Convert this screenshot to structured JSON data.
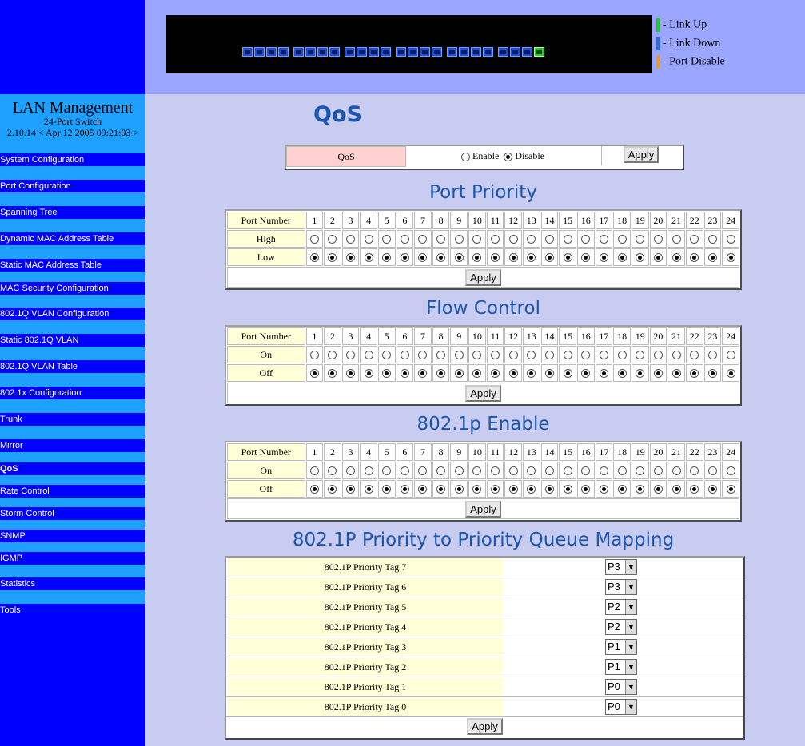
{
  "sidebar": {
    "title": "LAN Management",
    "subtitle": "24-Port Switch",
    "version": "2.10.14 < Apr 12 2005 09:21:03 >",
    "items": [
      {
        "label": "System Configuration"
      },
      {
        "label": "Port Configuration"
      },
      {
        "label": "Spanning Tree"
      },
      {
        "label": "Dynamic MAC Address Table"
      },
      {
        "label": "Static MAC Address Table"
      },
      {
        "label": "MAC Security Configuration"
      },
      {
        "label": "802.1Q VLAN Configuration"
      },
      {
        "label": "Static 802.1Q VLAN"
      },
      {
        "label": "802.1Q VLAN Table"
      },
      {
        "label": "802.1x Configuration"
      },
      {
        "label": "Trunk"
      },
      {
        "label": "Mirror"
      },
      {
        "label": "QoS",
        "active": true
      },
      {
        "label": "Rate Control"
      },
      {
        "label": "Storm Control"
      },
      {
        "label": "SNMP"
      },
      {
        "label": "IGMP"
      },
      {
        "label": "Statistics"
      },
      {
        "label": " Tools"
      }
    ]
  },
  "legend": [
    {
      "label": "- Link Up",
      "color": "#22cc22"
    },
    {
      "label": "- Link Down",
      "color": "#2a6ae8"
    },
    {
      "label": "- Port Disable",
      "color": "#e89a2a"
    }
  ],
  "ports_up": [
    24
  ],
  "page_title": "QoS",
  "qos": {
    "label": "QoS",
    "enable_label": "Enable",
    "disable_label": "Disable",
    "selected": "Disable",
    "apply": "Apply"
  },
  "port_priority": {
    "title": "Port Priority",
    "header": "Port Number",
    "rows": [
      {
        "label": "High",
        "checked": false
      },
      {
        "label": "Low",
        "checked": true
      }
    ],
    "apply": "Apply"
  },
  "flow_control": {
    "title": "Flow Control",
    "header": "Port Number",
    "rows": [
      {
        "label": "On",
        "checked": false
      },
      {
        "label": "Off",
        "checked": true
      }
    ],
    "apply": "Apply"
  },
  "p8021p_enable": {
    "title": "802.1p Enable",
    "header": "Port Number",
    "rows": [
      {
        "label": "On",
        "checked": false
      },
      {
        "label": "Off",
        "checked": true
      }
    ],
    "apply": "Apply"
  },
  "ports": [
    "1",
    "2",
    "3",
    "4",
    "5",
    "6",
    "7",
    "8",
    "9",
    "10",
    "11",
    "12",
    "13",
    "14",
    "15",
    "16",
    "17",
    "18",
    "19",
    "20",
    "21",
    "22",
    "23",
    "24"
  ],
  "mapping": {
    "title": "802.1P Priority to Priority Queue Mapping",
    "rows": [
      {
        "label": "802.1P Priority Tag 7",
        "value": "P3"
      },
      {
        "label": "802.1P Priority Tag 6",
        "value": "P3"
      },
      {
        "label": "802.1P Priority Tag 5",
        "value": "P2"
      },
      {
        "label": "802.1P Priority Tag 4",
        "value": "P2"
      },
      {
        "label": "802.1P Priority Tag 3",
        "value": "P1"
      },
      {
        "label": "802.1P Priority Tag 2",
        "value": "P1"
      },
      {
        "label": "802.1P Priority Tag 1",
        "value": "P0"
      },
      {
        "label": "802.1P Priority Tag 0",
        "value": "P0"
      }
    ],
    "apply": "Apply"
  }
}
